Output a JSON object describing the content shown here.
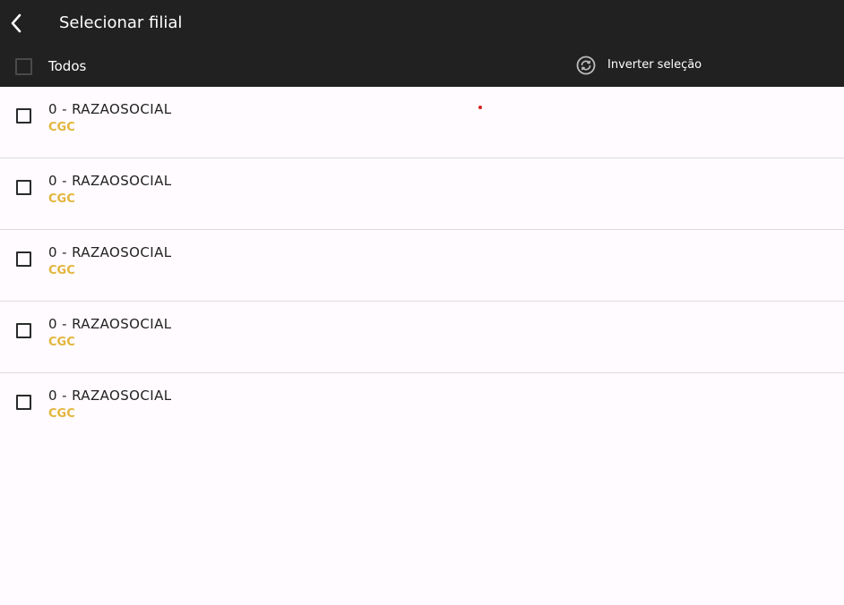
{
  "header": {
    "title": "Selecionar filial",
    "select_all_label": "Todos",
    "invert_label": "Inverter seleção"
  },
  "icons": {
    "back": "chevron-left-icon",
    "invert": "swap-circle-icon",
    "checkbox": "checkbox-unchecked-icon"
  },
  "colors": {
    "header_bg": "#212121",
    "subtitle": "#e3b53c",
    "page_bg": "#fffbfe"
  },
  "items": [
    {
      "title": "0 - RAZAOSOCIAL",
      "subtitle": "CGC",
      "checked": false
    },
    {
      "title": "0 - RAZAOSOCIAL",
      "subtitle": "CGC",
      "checked": false
    },
    {
      "title": "0 - RAZAOSOCIAL",
      "subtitle": "CGC",
      "checked": false
    },
    {
      "title": "0 - RAZAOSOCIAL",
      "subtitle": "CGC",
      "checked": false
    },
    {
      "title": "0 - RAZAOSOCIAL",
      "subtitle": "CGC",
      "checked": false
    }
  ]
}
